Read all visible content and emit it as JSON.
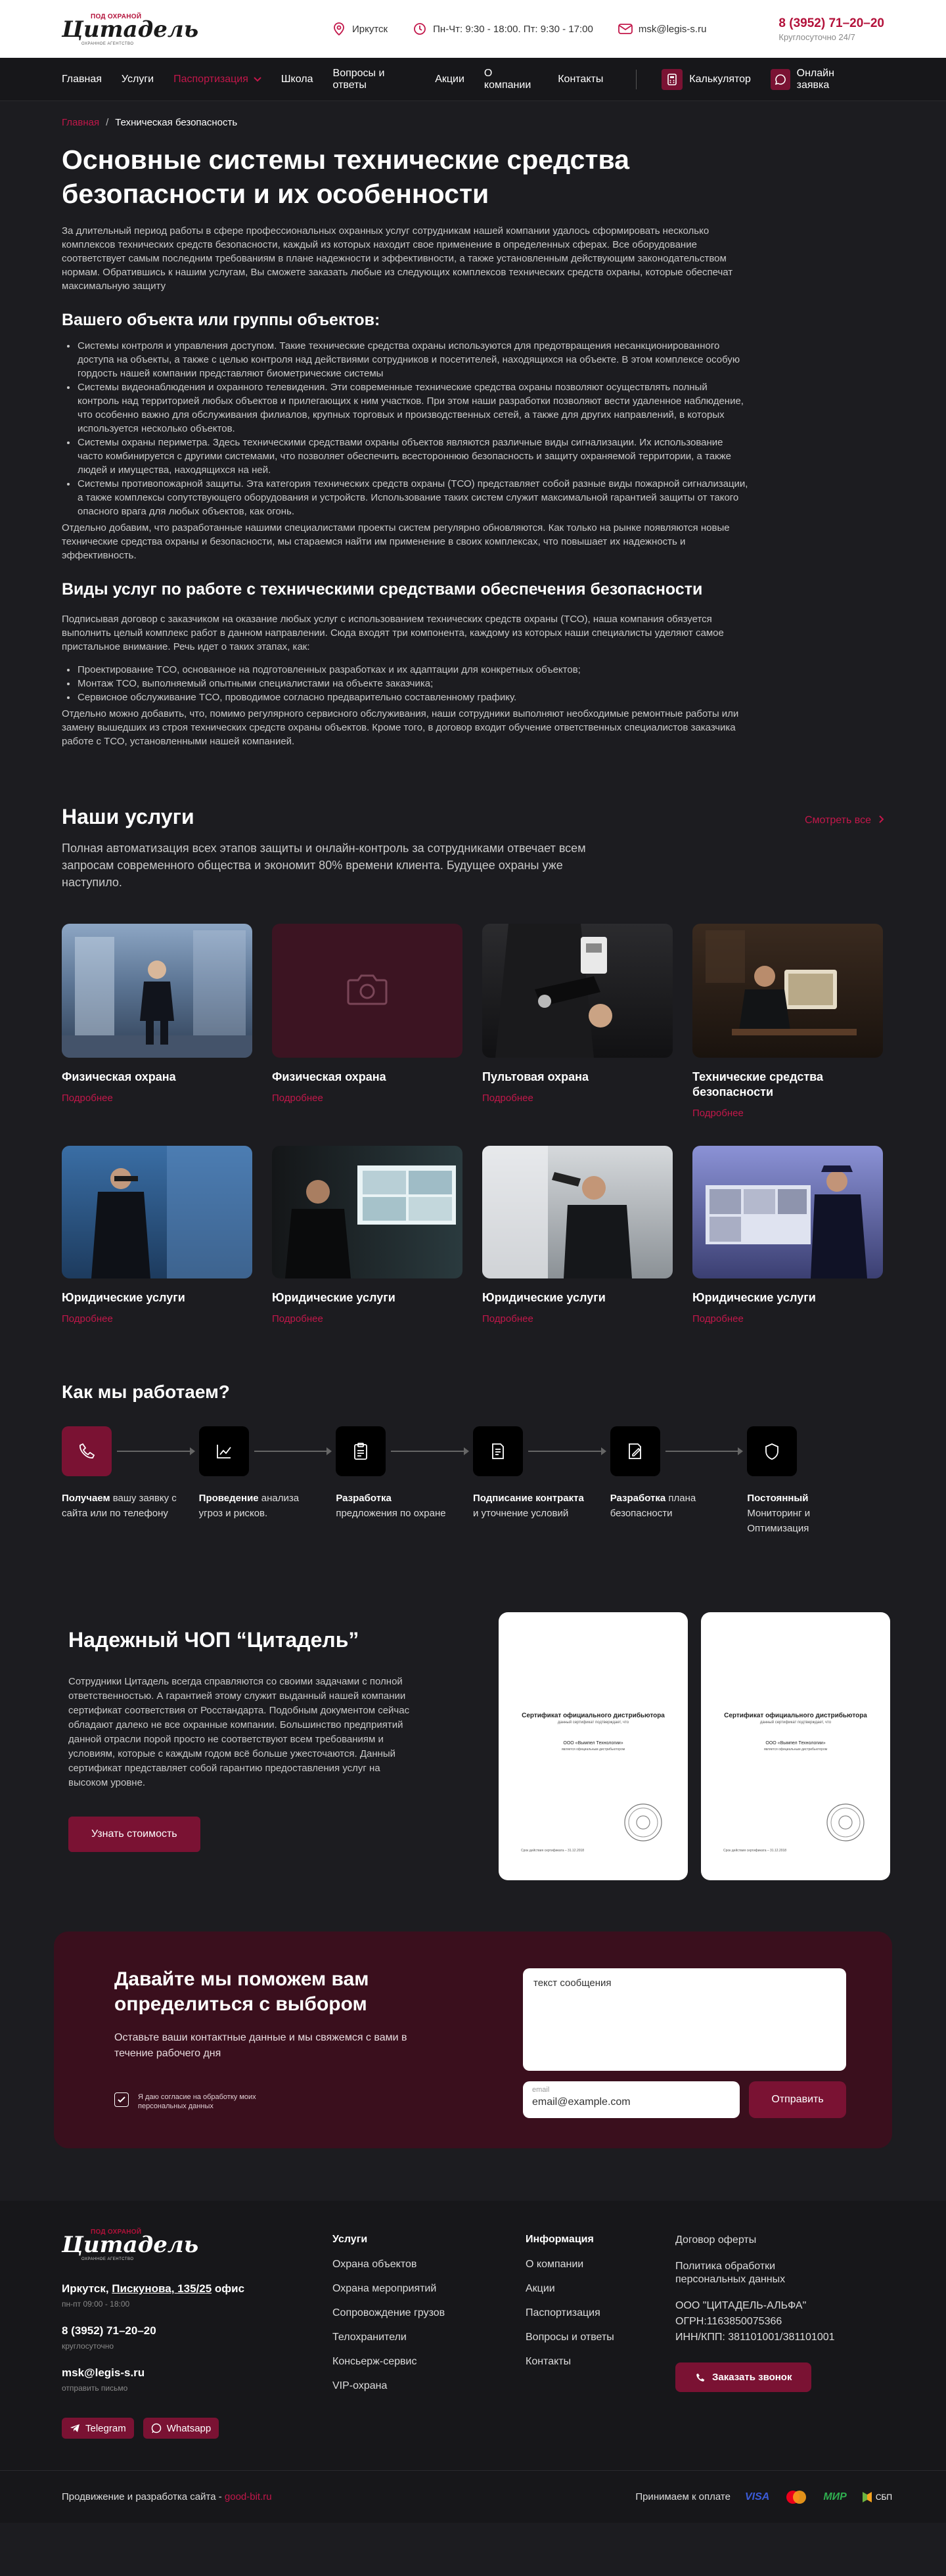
{
  "header": {
    "logo": {
      "tag": "ПОД ОХРАНОЙ",
      "main": "Цитадель",
      "sub": "охранное агентство"
    },
    "city": "Иркутск",
    "hours": "Пн-Чт: 9:30 - 18:00. Пт: 9:30 - 17:00",
    "email": "msk@legis-s.ru",
    "phone": "8 (3952) 71–20–20",
    "phone_note": "Круглосуточно 24/7"
  },
  "nav": {
    "items": [
      "Главная",
      "Услуги",
      "Паспортизация",
      "Школа",
      "Вопросы и ответы",
      "Акции",
      "О компании",
      "Контакты"
    ],
    "calculator": "Калькулятор",
    "online_request": "Онлайн заявка",
    "accent": "#c2174a"
  },
  "breadcrumb": {
    "home": "Главная",
    "current": "Техническая безопасность"
  },
  "article": {
    "title": "Основные системы технические средства безопасности и их особенности",
    "intro": "За длительный период работы в сфере профессиональных охранных услуг сотрудникам нашей компании удалось сформировать несколько комплексов технических средств безопасности, каждый из которых находит свое применение в определенных сферах. Все оборудование соответствует самым последним требованиям в плане надежности и эффективности, а также установленным действующим законодательством нормам. Обратившись к нашим услугам, Вы сможете заказать любые из следующих комплексов технических средств охраны, которые обеспечат максимальную защиту",
    "h2_1": "Вашего объекта или группы объектов:",
    "list1": [
      "Системы контроля и управления доступом. Такие технические средства охраны используются для предотвращения несанкционированного доступа на объекты, а также с целью контроля над действиями сотрудников и посетителей, находящихся на объекте. В этом комплексе особую гордость нашей компании представляют биометрические системы",
      "Системы видеонаблюдения и охранного телевидения. Эти современные технические средства охраны позволяют осуществлять полный контроль над территорией любых объектов и прилегающих к ним участков. При этом наши разработки позволяют вести удаленное наблюдение, что особенно важно для обслуживания филиалов, крупных торговых и производственных сетей, а также для других направлений, в которых используется несколько объектов.",
      "Системы охраны периметра. Здесь техническими средствами охраны объектов являются различные виды сигнализации. Их использование часто комбинируется с другими системами, что позволяет обеспечить всестороннюю безопасность и защиту охраняемой территории, а также людей и имущества, находящихся на ней.",
      "Системы противопожарной защиты. Эта категория технических средств охраны (ТСО) представляет собой разные виды пожарной сигнализации, а также комплексы сопутствующего оборудования и устройств. Использование таких систем служит максимальной гарантией защиты от такого опасного врага для любых объектов, как огонь."
    ],
    "para2": "Отдельно добавим, что разработанные нашими специалистами проекты систем регулярно обновляются. Как только на рынке появляются новые технические средства охраны и безопасности, мы стараемся найти им применение в своих комплексах, что повышает их надежность и эффективность.",
    "h2_2": "Виды услуг по работе с техническими средствами обеспечения безопасности",
    "para3": "Подписывая договор с заказчиком на оказание любых услуг с использованием технических средств охраны (ТСО), наша компания  обязуется выполнить целый комплекс работ в данном направлении. Сюда входят три компонента, каждому из которых наши специалисты уделяют самое пристальное внимание. Речь идет о таких этапах, как:",
    "list2": [
      "Проектирование ТСО, основанное на подготовленных разработках и их адаптации для конкретных объектов;",
      "Монтаж ТСО, выполняемый опытными специалистами на объекте заказчика;",
      "Сервисное обслуживание ТСО, проводимое согласно предварительно составленному графику."
    ],
    "para4": "Отдельно можно добавить, что, помимо регулярного сервисного обслуживания, наши сотрудники выполняют необходимые ремонтные работы или замену вышедших из строя технических средств охраны объектов. Кроме того, в договор входит обучение ответственных специалистов заказчика работе с ТСО, установленными нашей компанией."
  },
  "services": {
    "title": "Наши услуги",
    "see_all": "Смотреть все",
    "lead": "Полная автоматизация всех этапов защиты и онлайн-контроль за сотрудниками отвечает всем запросам современного общества и экономит 80% времени клиента. Будущее охраны уже наступило.",
    "more": "Подробнее",
    "cards": [
      {
        "title": "Физическая охрана"
      },
      {
        "title": "Физическая охрана"
      },
      {
        "title": "Пультовая охрана"
      },
      {
        "title": "Технические средства безопасности"
      },
      {
        "title": "Юридические услуги"
      },
      {
        "title": "Юридические услуги"
      },
      {
        "title": "Юридические услуги"
      },
      {
        "title": "Юридические услуги"
      }
    ]
  },
  "how": {
    "title": "Как мы работаем?",
    "steps": [
      {
        "bold": "Получаем",
        "rest": " вашу заявку с сайта или по телефону"
      },
      {
        "bold": "Проведение",
        "rest": " анализа угроз и рисков."
      },
      {
        "bold": "Разработка",
        "rest": " предложения по охране"
      },
      {
        "bold": "Подписание контракта",
        "rest": " и уточнение условий"
      },
      {
        "bold": "Разработка",
        "rest": " плана безопасности"
      },
      {
        "bold": "Постоянный",
        "rest": " Мониторинг и Оптимизация"
      }
    ]
  },
  "reliable": {
    "title": "Надежный ЧОП “Цитадель”",
    "text": "Сотрудники Цитадель всегда справляются со своими задачами с полной ответственностью. А гарантией этому служит выданный нашей компании сертификат соответствия от Росстандарта. Подобным документом сейчас обладают далеко не все охранные компании. Большинство предприятий данной отрасли порой просто не соответствуют всем требованиям и условиям, которые с каждым годом всё больше ужесточаются. Данный сертификат представляет собой гарантию предоставления услуг на высоком уровне.",
    "button": "Узнать стоимость",
    "certificate": {
      "title": "Сертификат официального дистрибьютора",
      "subtitle": "данный сертификат подтверждает, что",
      "org": "ООО «Вымпел Технологии»",
      "org_sub": "является официальным дистрибьютором",
      "footer": "Срок действия сертификата – 31.12.2018"
    }
  },
  "contact_form": {
    "title": "Давайте мы поможем вам определиться с выбором",
    "lead": "Оставьте ваши контактные данные и мы свяжемся с вами в течение рабочего дня",
    "agree": "Я даю согласие на обработку моих персональных данных",
    "message_placeholder": "текст сообщения",
    "email_label": "email",
    "email_value": "email@example.com",
    "submit": "Отправить"
  },
  "footer": {
    "logo": {
      "tag": "ПОД ОХРАНОЙ",
      "main": "Цитадель",
      "sub": "охранное агентство"
    },
    "address_city": "Иркутск, ",
    "address_street": "Пискунова, 135/25",
    "address_rest": " офис",
    "hours": "пн-пт 09:00 - 18:00",
    "phone": "8 (3952) 71–20–20",
    "phone_note": "круглосуточно",
    "email": "msk@legis-s.ru",
    "email_note": "отправить письмо",
    "social": [
      "Telegram",
      "Whatsapp"
    ],
    "services_title": "Услуги",
    "services": [
      "Охрана объектов",
      "Охрана мероприятий",
      "Сопровождение грузов",
      "Телохранители",
      "Консьерж-сервис",
      "VIP-охрана"
    ],
    "info_title": "Информация",
    "info": [
      "О компании",
      "Акции",
      "Паспортизация",
      "Вопросы и ответы",
      "Контакты"
    ],
    "docs": [
      "Договор оферты",
      "Политика обработки персональных данных"
    ],
    "requisites": [
      "ООО \"ЦИТАДЕЛЬ-АЛЬФА\"",
      "ОГРН:1163850075366",
      "ИНН/КПП: 381101001/381101001"
    ],
    "order_call": "Заказать звонок",
    "dev_text": "Продвижение и разработка сайта - ",
    "dev_link": "good-bit.ru",
    "pay_text": "Принимаем к оплате",
    "pay": [
      "VISA",
      "Mastercard",
      "МИР",
      "СБП"
    ]
  }
}
